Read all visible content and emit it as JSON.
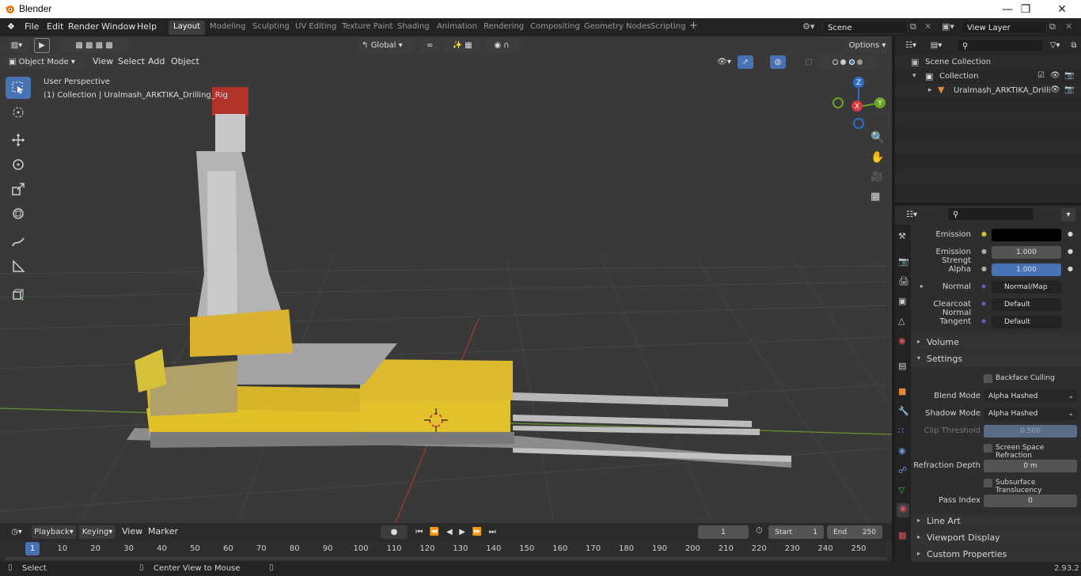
{
  "window": {
    "title": "Blender",
    "min_icon": "minimize-icon",
    "max_icon": "maximize-icon",
    "close_icon": "close-icon"
  },
  "menu": [
    "File",
    "Edit",
    "Render",
    "Window",
    "Help"
  ],
  "workspaces": [
    "Layout",
    "Modeling",
    "Sculpting",
    "UV Editing",
    "Texture Paint",
    "Shading",
    "Animation",
    "Rendering",
    "Compositing",
    "Geometry Nodes",
    "Scripting"
  ],
  "active_workspace": "Layout",
  "scene": "Scene",
  "view_layer": "View Layer",
  "viewport_header": {
    "mode": "Object Mode",
    "menus": [
      "View",
      "Select",
      "Add",
      "Object"
    ],
    "orientation": "Global",
    "options": "Options"
  },
  "viewport_overlay": {
    "perspective": "User Perspective",
    "collection": "(1) Collection | Uralmash_ARKTIKA_Drilling_Rig"
  },
  "gizmo": {
    "z": "Z",
    "x": "X",
    "y": "Y"
  },
  "outliner": {
    "root": "Scene Collection",
    "collection": "Collection",
    "object": "Uralmash_ARKTIKA_Drilli"
  },
  "properties": {
    "rows": [
      {
        "label": "Emission",
        "value": "",
        "kind": "color"
      },
      {
        "label": "Emission Strengt",
        "value": "1.000",
        "kind": "num"
      },
      {
        "label": "Alpha",
        "value": "1.000",
        "kind": "blue"
      },
      {
        "label": "Normal",
        "value": "Normal/Map",
        "kind": "link"
      },
      {
        "label": "Clearcoat Normal",
        "value": "Default",
        "kind": "link"
      },
      {
        "label": "Tangent",
        "value": "Default",
        "kind": "link"
      }
    ],
    "volume": "Volume",
    "settings": "Settings",
    "backface_culling": "Backface Culling",
    "blend_mode_label": "Blend Mode",
    "blend_mode": "Alpha Hashed",
    "shadow_mode_label": "Shadow Mode",
    "shadow_mode": "Alpha Hashed",
    "clip_threshold_label": "Clip Threshold",
    "clip_threshold": "0.500",
    "ssr": "Screen Space Refraction",
    "refraction_depth_label": "Refraction Depth",
    "refraction_depth": "0 m",
    "subsurface": "Subsurface Translucency",
    "pass_index_label": "Pass Index",
    "pass_index": "0",
    "line_art": "Line Art",
    "viewport_display": "Viewport Display",
    "custom_properties": "Custom Properties"
  },
  "timeline": {
    "menus": [
      "Playback",
      "Keying",
      "View",
      "Marker"
    ],
    "current_frame": "1",
    "start_label": "Start",
    "start": "1",
    "end_label": "End",
    "end": "250",
    "ticks": [
      "1",
      "10",
      "20",
      "30",
      "40",
      "50",
      "60",
      "70",
      "80",
      "90",
      "100",
      "110",
      "120",
      "130",
      "140",
      "150",
      "160",
      "170",
      "180",
      "190",
      "200",
      "210",
      "220",
      "230",
      "240",
      "250"
    ]
  },
  "status": {
    "select": "Select",
    "center": "Center View to Mouse",
    "version": "2.93.2"
  }
}
